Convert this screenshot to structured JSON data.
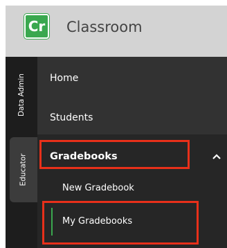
{
  "header": {
    "logo_text": "Cr",
    "app_title": "Classroom"
  },
  "rail": {
    "tabs": [
      {
        "label": "Data Admin",
        "active": false
      },
      {
        "label": "Educator",
        "active": true
      }
    ]
  },
  "nav": {
    "items": [
      {
        "label": "Home"
      },
      {
        "label": "Students"
      },
      {
        "label": "Gradebooks",
        "expanded": true,
        "chevron": "chevron-up-icon"
      }
    ],
    "gradebooks_sub": [
      {
        "label": "New Gradebook",
        "active": false
      },
      {
        "label": "My Gradebooks",
        "active": true
      }
    ]
  },
  "colors": {
    "brand_green": "#3aa84f",
    "highlight_red": "#e8301a",
    "nav_bg": "#323232",
    "rail_bg": "#1d1d1d",
    "header_bg": "#d3d3d3"
  }
}
